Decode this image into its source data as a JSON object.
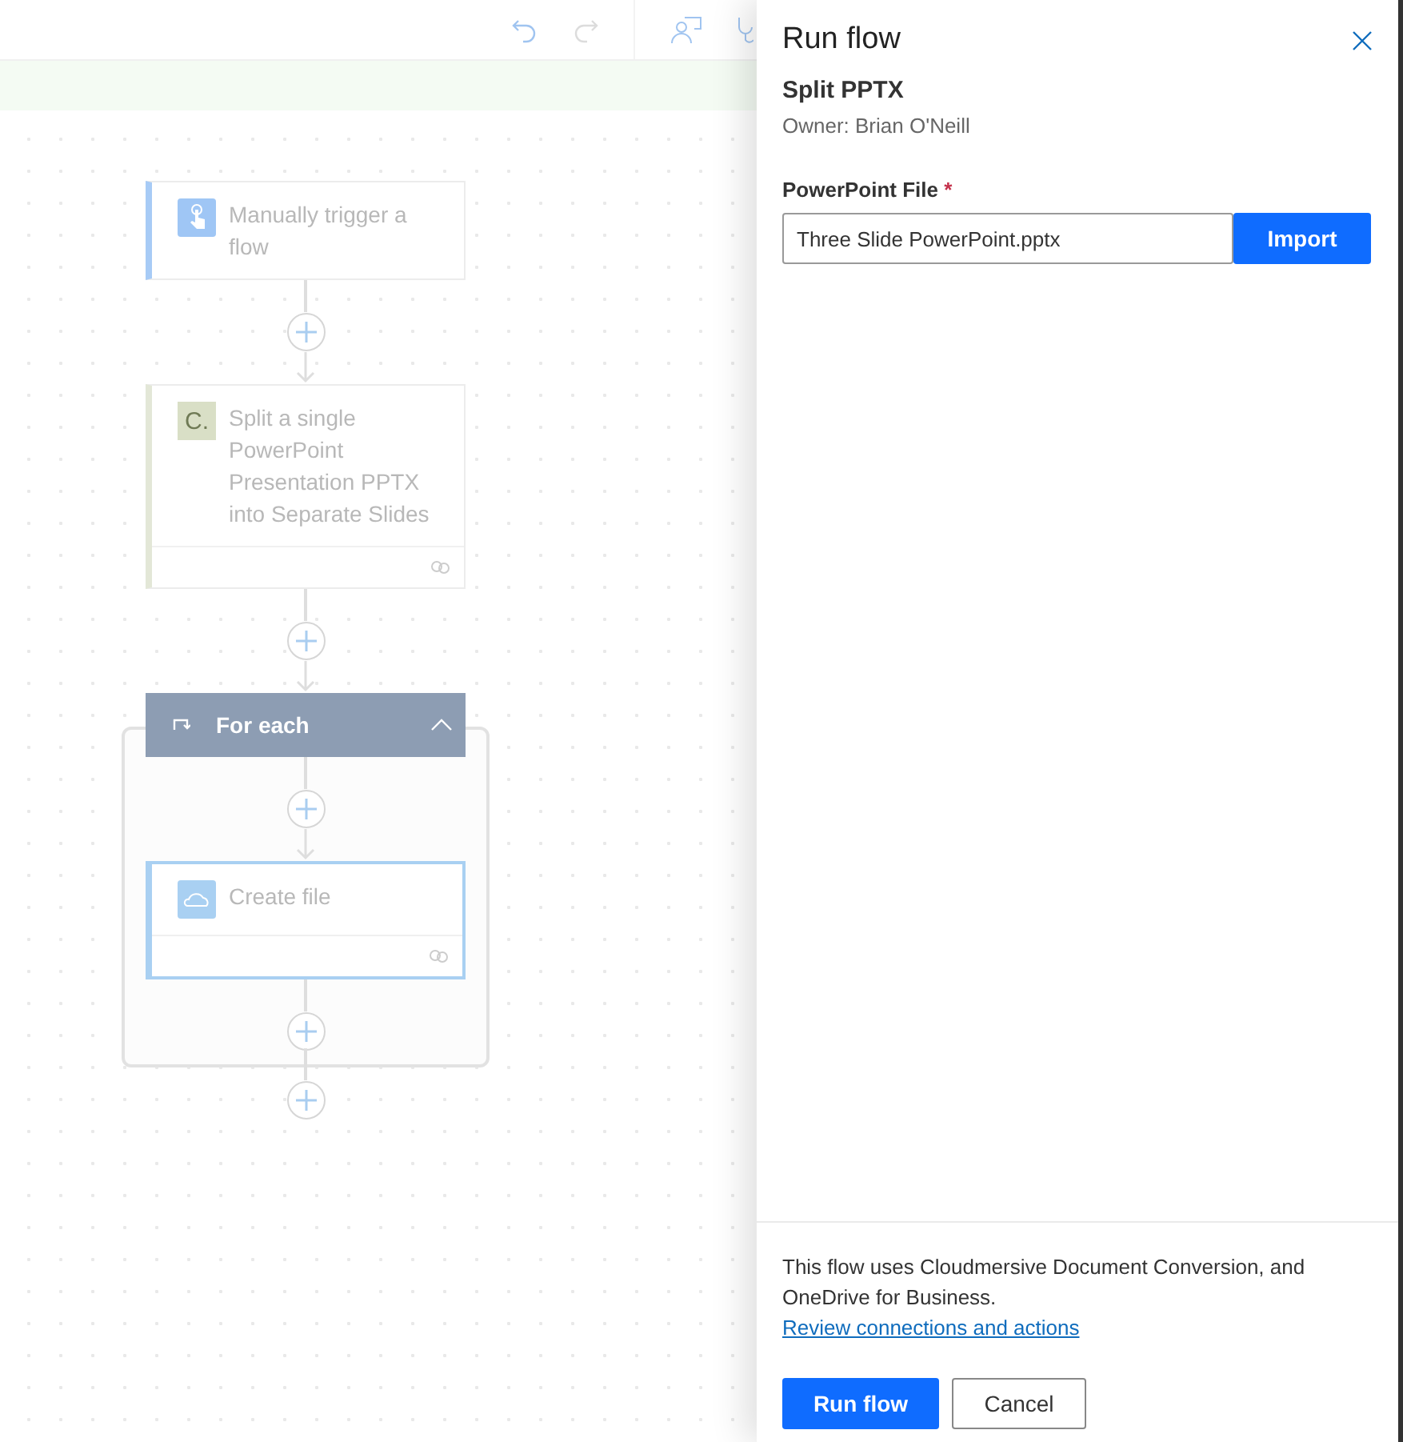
{
  "canvas": {
    "steps": [
      {
        "kind": "trigger",
        "title": "Manually trigger a flow",
        "selected": false
      },
      {
        "kind": "action",
        "title": "Split a single PowerPoint Presentation PPTX into Separate Slides",
        "badge": "C.",
        "selected": false
      },
      {
        "kind": "loop",
        "title": "For each",
        "expanded": true,
        "children": [
          {
            "kind": "onedrive",
            "title": "Create file",
            "selected": true
          }
        ]
      }
    ]
  },
  "panel": {
    "title": "Run flow",
    "flow_name": "Split PPTX",
    "owner": "Owner: Brian O'Neill",
    "field": {
      "label": "PowerPoint File",
      "required_mark": "*",
      "value": "Three Slide PowerPoint.pptx",
      "button": "Import"
    },
    "notice": "This flow uses Cloudmersive Document Conversion, and OneDrive for Business.",
    "link": "Review connections and actions",
    "buttons": [
      {
        "label": "Run flow",
        "kind": "primary"
      },
      {
        "label": "Cancel",
        "kind": "secondary"
      }
    ]
  }
}
